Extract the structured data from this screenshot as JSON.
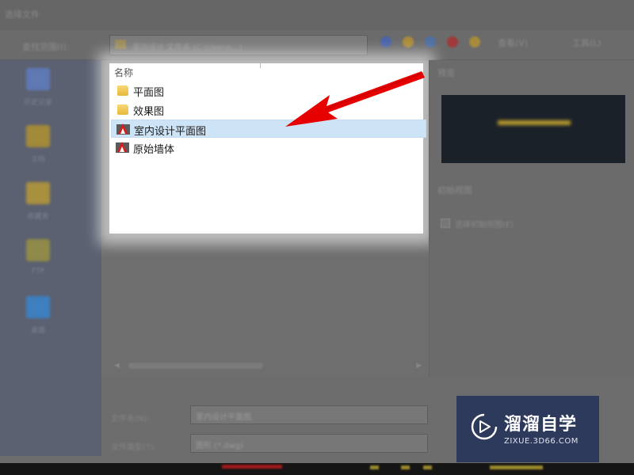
{
  "window": {
    "title": "选择文件"
  },
  "toolbar": {
    "look_in_label": "查找范围(I):",
    "path": "室内设计 文件夹 (C:\\Users\\...)",
    "views_label": "查看(V)",
    "tools_label": "工具(L)"
  },
  "sidebar": {
    "items": [
      {
        "label": "历史记录",
        "icon": "history-icon"
      },
      {
        "label": "文档",
        "icon": "documents-icon"
      },
      {
        "label": "收藏夹",
        "icon": "favorites-icon"
      },
      {
        "label": "FTP",
        "icon": "ftp-icon"
      },
      {
        "label": "桌面",
        "icon": "desktop-icon"
      }
    ]
  },
  "file_list": {
    "column_header": "名称",
    "items": [
      {
        "name": "平面图",
        "type": "folder",
        "selected": false
      },
      {
        "name": "效果图",
        "type": "folder",
        "selected": false
      },
      {
        "name": "室内设计平面图",
        "type": "dwg",
        "selected": true
      },
      {
        "name": "原始墙体",
        "type": "dwg",
        "selected": false
      }
    ]
  },
  "preview": {
    "label": "预览",
    "options_label": "初始视图",
    "checkbox_label": "选择初始视图(E)",
    "checkbox_checked": false
  },
  "bottom": {
    "filename_label": "文件名(N):",
    "filename_value": "室内设计平面图",
    "filetype_label": "文件类型(T):",
    "filetype_value": "图形 (*.dwg)"
  },
  "logo": {
    "name_cn": "溜溜自学",
    "url": "ZIXUE.3D66.COM"
  },
  "colors": {
    "selection": "#cde4f7",
    "arrow": "#e60000",
    "logo_bg": "#2d3a5c",
    "folder": "#f0c552"
  }
}
